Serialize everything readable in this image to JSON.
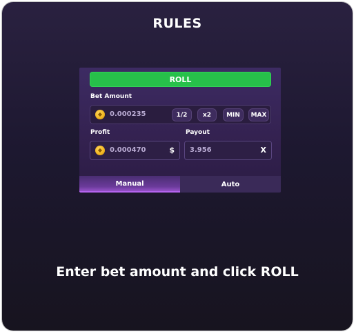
{
  "dialog": {
    "title": "RULES",
    "caption": "Enter bet amount and click ROLL"
  },
  "panel": {
    "roll_label": "ROLL",
    "bet_amount_label": "Bet Amount",
    "bet_amount_value": "0.000235",
    "bet_buttons": [
      "1/2",
      "x2",
      "MIN",
      "MAX"
    ],
    "profit_label": "Profit",
    "profit_value": "0.000470",
    "profit_suffix": "$",
    "payout_label": "Payout",
    "payout_value": "3.956",
    "payout_suffix": "X",
    "tabs": [
      {
        "label": "Manual",
        "active": true
      },
      {
        "label": "Auto",
        "active": false
      }
    ]
  },
  "colors": {
    "roll_green": "#27c04a",
    "coin_gold": "#f3b823",
    "tab_active_accent": "#b463ee"
  },
  "icons": {
    "currency": "coin-icon"
  }
}
